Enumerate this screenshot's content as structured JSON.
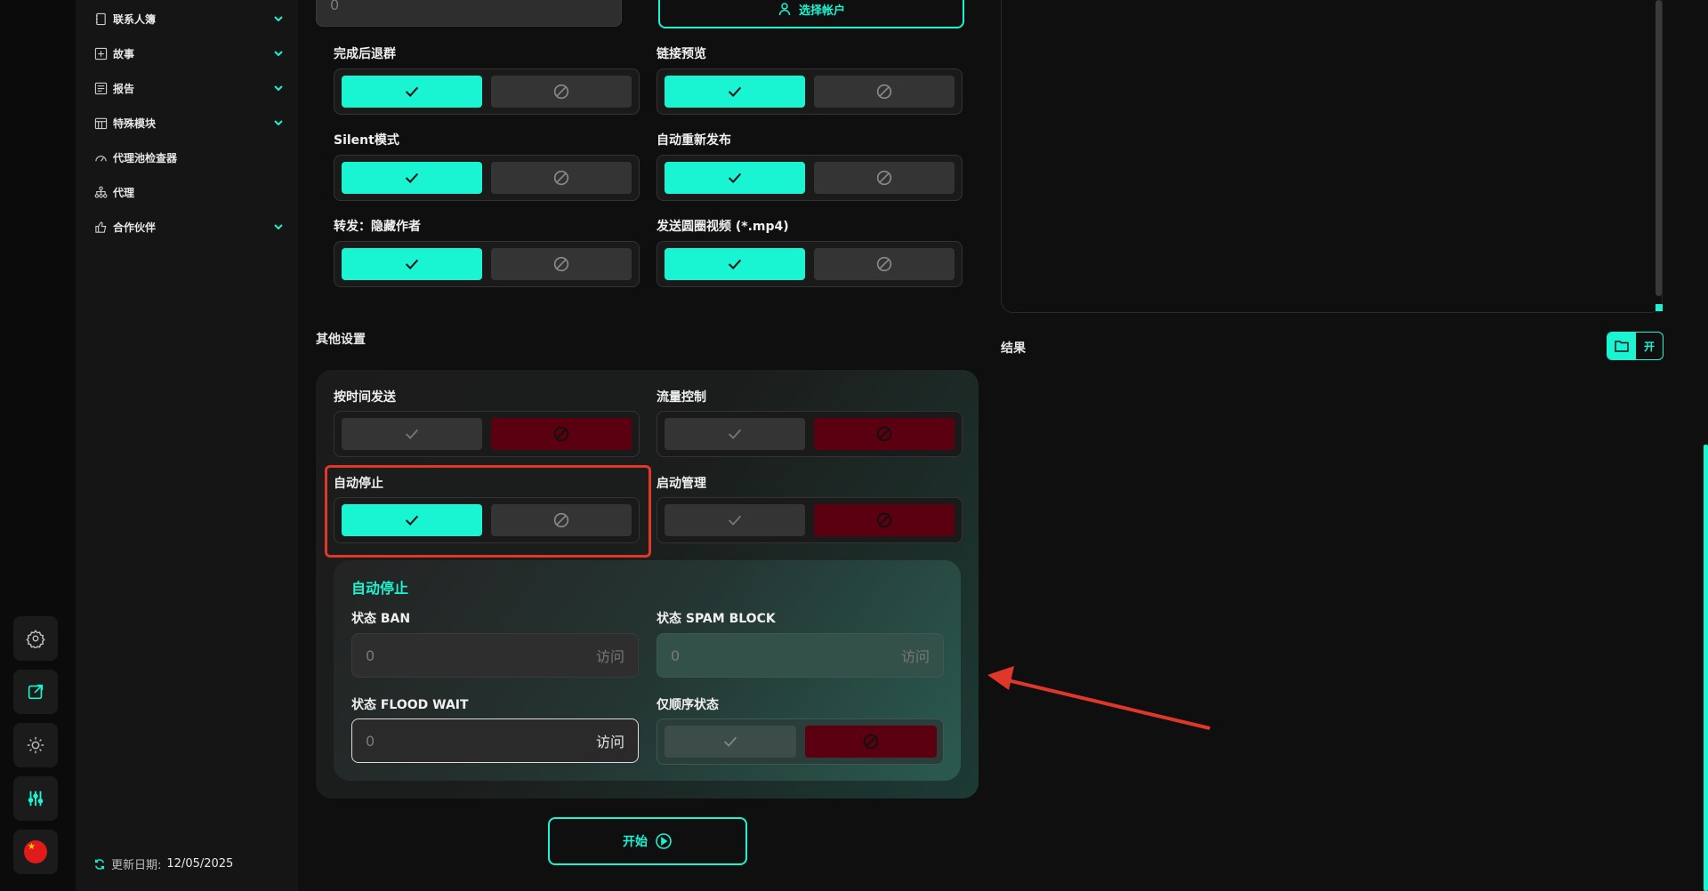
{
  "colors": {
    "accent": "#19f5d3",
    "danger": "#5a0010",
    "annotation": "#e0372b"
  },
  "nav": {
    "items": [
      {
        "label": "联系人簿",
        "icon": "contacts-icon",
        "expandable": true
      },
      {
        "label": "故事",
        "icon": "plus-square-icon",
        "expandable": true
      },
      {
        "label": "报告",
        "icon": "report-icon",
        "expandable": true
      },
      {
        "label": "特殊模块",
        "icon": "calendar-icon",
        "expandable": true
      },
      {
        "label": "代理池检查器",
        "icon": "gauge-icon",
        "expandable": false
      },
      {
        "label": "代理",
        "icon": "network-icon",
        "expandable": false
      },
      {
        "label": "合作伙伴",
        "icon": "thumbs-up-icon",
        "expandable": true
      }
    ],
    "update_label": "更新日期:",
    "update_date": "12/05/2025"
  },
  "top_input": {
    "value": "0"
  },
  "select_account": {
    "label": "选择帐户"
  },
  "toggles_top": [
    {
      "label": "完成后退群",
      "state": "on"
    },
    {
      "label": "链接预览",
      "state": "on"
    },
    {
      "label": "Silent模式",
      "state": "on"
    },
    {
      "label": "自动重新发布",
      "state": "on"
    },
    {
      "label": "转发：隐藏作者",
      "state": "on"
    },
    {
      "label": "发送圆圈视频 (*.mp4)",
      "state": "on"
    }
  ],
  "other_settings": {
    "title": "其他设置",
    "toggles": [
      {
        "label": "按时间发送",
        "state": "off"
      },
      {
        "label": "流量控制",
        "state": "off"
      },
      {
        "label": "自动停止",
        "state": "on"
      },
      {
        "label": "启动管理",
        "state": "off"
      }
    ],
    "auto_stop": {
      "title": "自动停止",
      "fields": [
        {
          "label": "状态 BAN",
          "value": "0",
          "unit": "访问"
        },
        {
          "label": "状态 SPAM BLOCK",
          "value": "0",
          "unit": "访问"
        },
        {
          "label": "状态 FLOOD WAIT",
          "value": "0",
          "unit": "访问"
        }
      ],
      "order_only": {
        "label": "仅顺序状态",
        "state": "off"
      }
    }
  },
  "start_button": {
    "label": "开始"
  },
  "result": {
    "label": "结果",
    "open_label": "开"
  }
}
